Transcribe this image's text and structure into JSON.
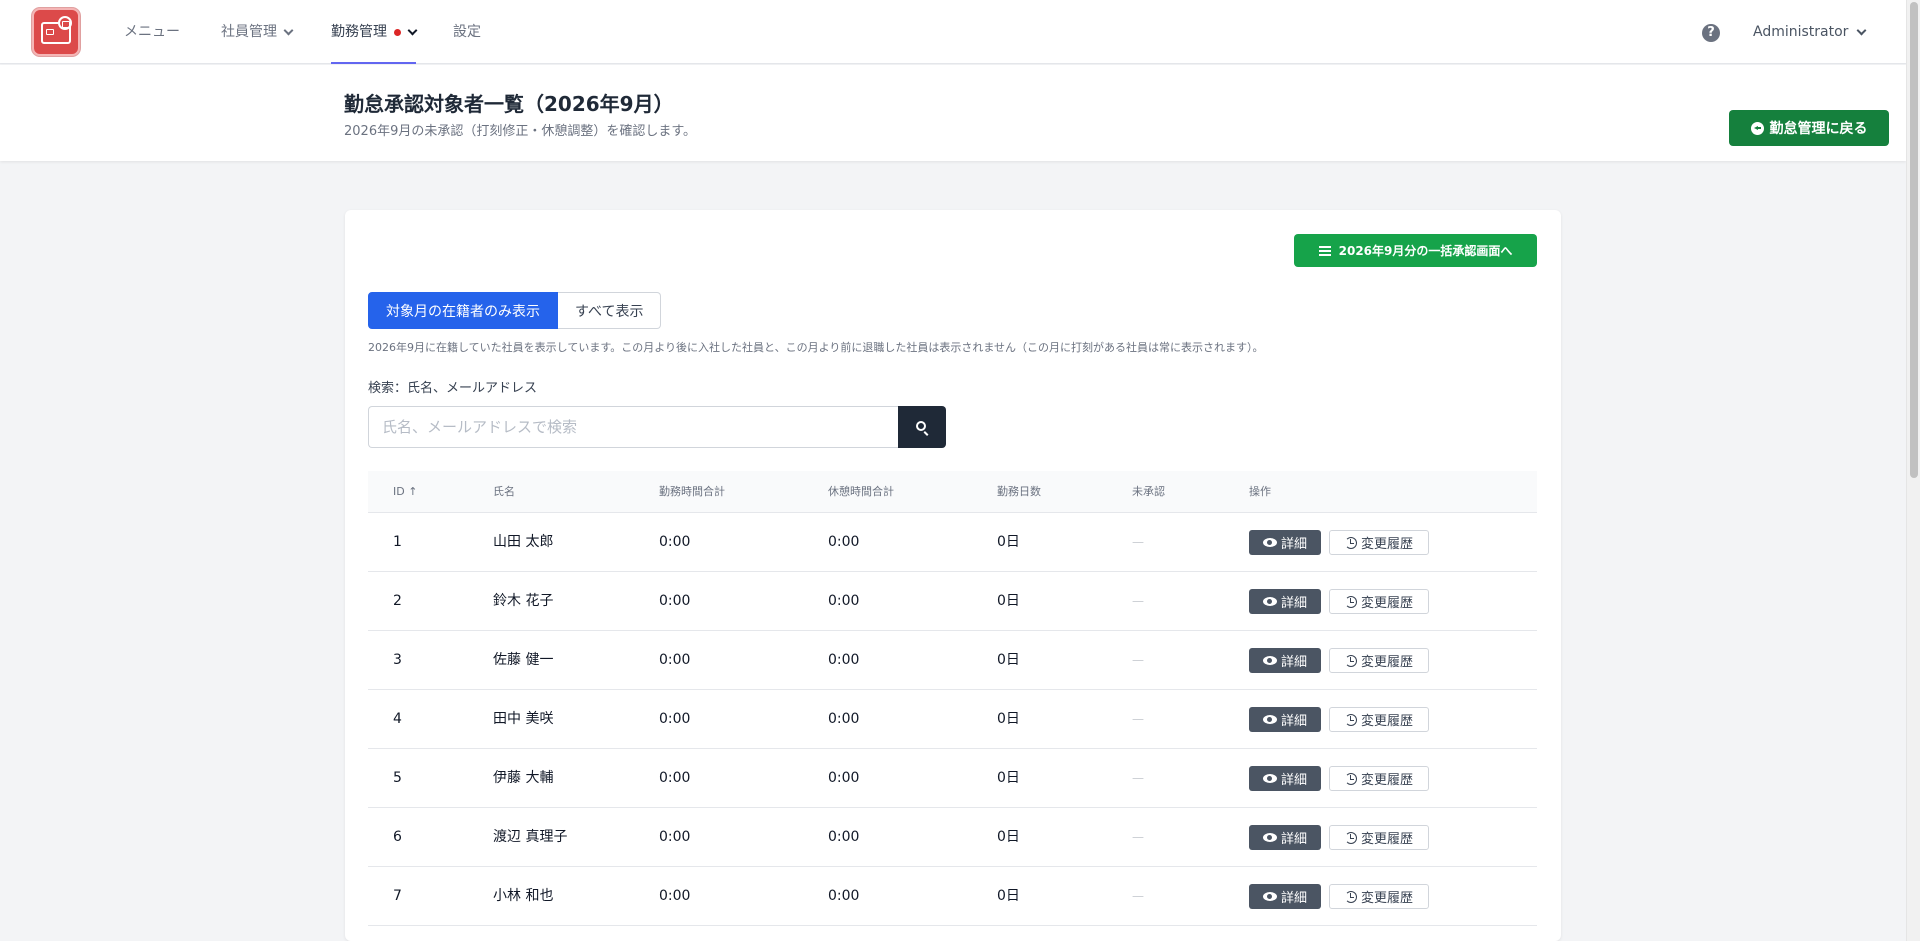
{
  "nav": {
    "items": [
      {
        "label": "メニュー"
      },
      {
        "label": "社員管理"
      },
      {
        "label": "勤務管理"
      },
      {
        "label": "設定"
      }
    ],
    "user": "Administrator"
  },
  "header": {
    "title": "勤怠承認対象者一覧（2026年9月）",
    "subtitle": "2026年9月の未承認（打刻修正・休憩調整）を確認します。",
    "back_button": "勤怠管理に戻る"
  },
  "main": {
    "bulk_button": "2026年9月分の一括承認画面へ",
    "filter": {
      "active_label": "対象月の在籍者のみ表示",
      "all_label": "すべて表示"
    },
    "note": "2026年9月に在籍していた社員を表示しています。この月より後に入社した社員と、この月より前に退職した社員は表示されません（この月に打刻がある社員は常に表示されます）。",
    "search": {
      "label": "検索：氏名、メールアドレス",
      "placeholder": "氏名、メールアドレスで検索",
      "value": ""
    },
    "table": {
      "headers": [
        "ID ↑",
        "氏名",
        "勤務時間合計",
        "休憩時間合計",
        "勤務日数",
        "未承認",
        "操作"
      ],
      "detail_label": "詳細",
      "history_label": "変更履歴",
      "rows": [
        {
          "id": "1",
          "name": "山田 太郎",
          "work": "0:00",
          "break": "0:00",
          "days": "0日",
          "pending": "—"
        },
        {
          "id": "2",
          "name": "鈴木 花子",
          "work": "0:00",
          "break": "0:00",
          "days": "0日",
          "pending": "—"
        },
        {
          "id": "3",
          "name": "佐藤 健一",
          "work": "0:00",
          "break": "0:00",
          "days": "0日",
          "pending": "—"
        },
        {
          "id": "4",
          "name": "田中 美咲",
          "work": "0:00",
          "break": "0:00",
          "days": "0日",
          "pending": "—"
        },
        {
          "id": "5",
          "name": "伊藤 大輔",
          "work": "0:00",
          "break": "0:00",
          "days": "0日",
          "pending": "—"
        },
        {
          "id": "6",
          "name": "渡辺 真理子",
          "work": "0:00",
          "break": "0:00",
          "days": "0日",
          "pending": "—"
        },
        {
          "id": "7",
          "name": "小林 和也",
          "work": "0:00",
          "break": "0:00",
          "days": "0日",
          "pending": "—"
        }
      ]
    }
  },
  "colors": {
    "primary": "#2563eb",
    "success": "#16a34a",
    "success_dark": "#15803d",
    "nav_active_underline": "#6366f1",
    "alert_dot": "#dc2626",
    "logo": "#dc4a4a"
  },
  "icons": {
    "logo": "app-logo",
    "help": "question-circle-icon",
    "back": "arrow-circle-left-icon",
    "bulk": "list-icon",
    "search": "search-icon",
    "detail": "eye-icon",
    "history": "history-icon"
  }
}
